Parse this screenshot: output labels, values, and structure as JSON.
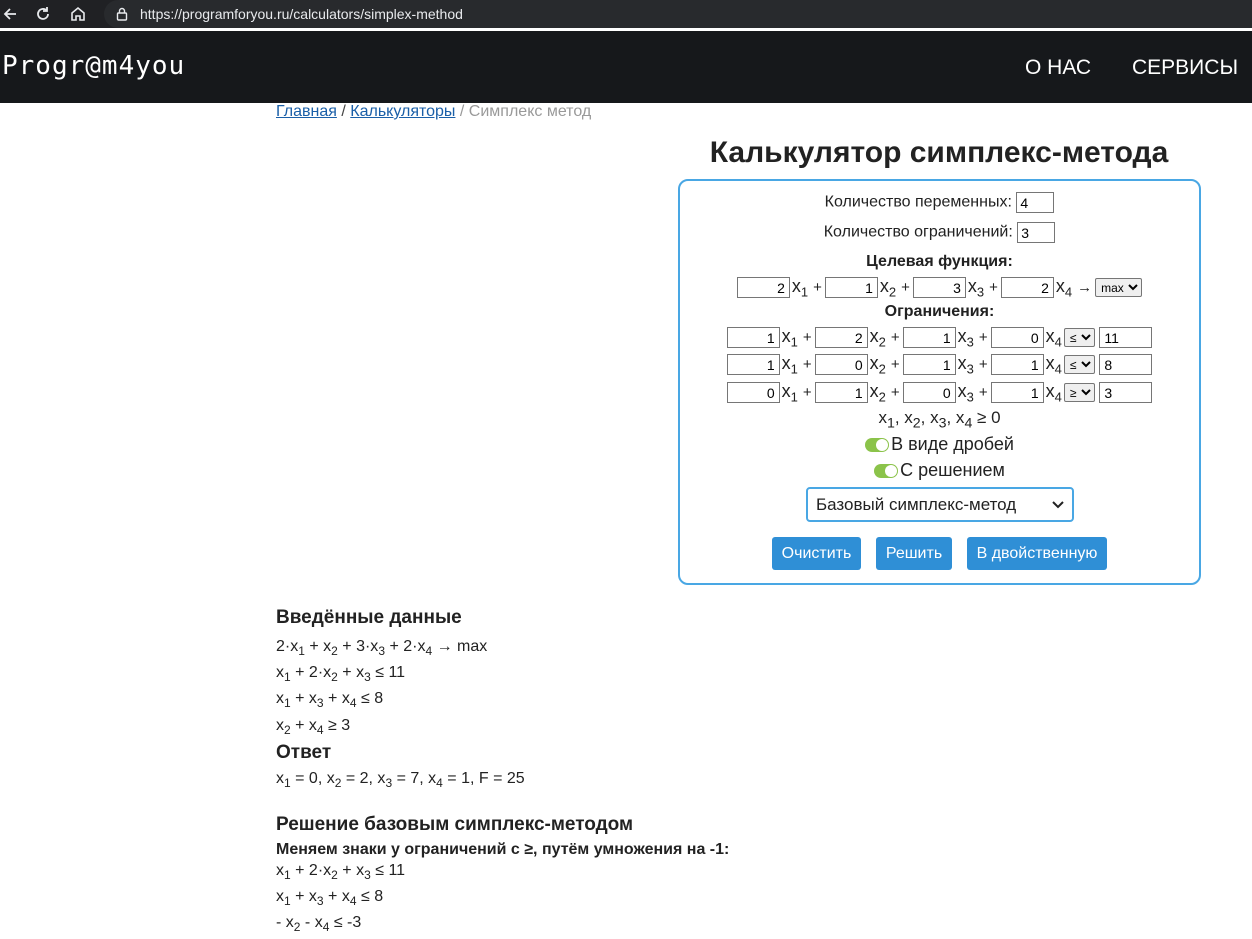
{
  "browser": {
    "url": "https://programforyou.ru/calculators/simplex-method"
  },
  "header": {
    "logo": "Progr@m4you",
    "nav_about": "О НАС",
    "nav_services": "СЕРВИСЫ"
  },
  "breadcrumb": {
    "home": "Главная",
    "sep": "/",
    "calculators": "Калькуляторы",
    "current": "Симплекс метод"
  },
  "calc": {
    "title": "Калькулятор симплекс-метода",
    "vars_label": "Количество переменных:",
    "vars_value": "4",
    "cons_label": "Количество ограничений:",
    "cons_value": "3",
    "objective_label": "Целевая функция:",
    "objective": [
      "2",
      "1",
      "3",
      "2"
    ],
    "objective_direction": "max",
    "constraints_label": "Ограничения:",
    "constraints": [
      {
        "coefs": [
          "1",
          "2",
          "1",
          "0"
        ],
        "sign": "≤",
        "rhs": "11"
      },
      {
        "coefs": [
          "1",
          "0",
          "1",
          "1"
        ],
        "sign": "≤",
        "rhs": "8"
      },
      {
        "coefs": [
          "0",
          "1",
          "0",
          "1"
        ],
        "sign": "≥",
        "rhs": "3"
      }
    ],
    "nonneg_tail": " ≥ 0",
    "toggle_fractions": "В виде дробей",
    "toggle_solution": "С решением",
    "method": "Базовый симплекс-метод",
    "btn_clear": "Очистить",
    "btn_solve": "Решить",
    "btn_dual": "В двойственную"
  },
  "results": {
    "input_title": "Введённые данные",
    "answer_title": "Ответ",
    "solution_title": "Решение базовым симплекс-методом",
    "solution_note": "Меняем знаки у ограничений с ≥, путём умножения на -1:"
  },
  "colors": {
    "accent": "#49a7e4",
    "button": "#2f8fd6",
    "header_bg": "#16181b",
    "toggle": "#8bc34a",
    "link": "#1a5fa8"
  }
}
